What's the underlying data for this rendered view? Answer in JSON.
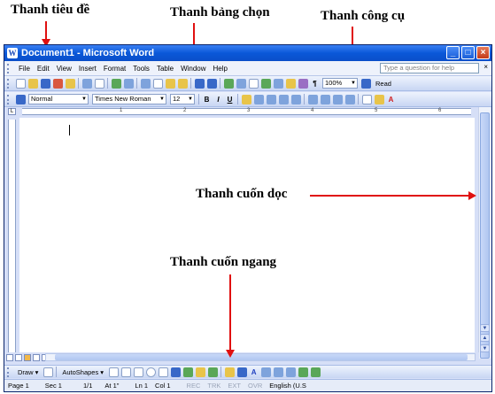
{
  "annotations": {
    "title_bar": "Thanh tiêu đề",
    "menu_bar": "Thanh bảng chọn",
    "toolbar": "Thanh công cụ",
    "vertical_scroll": "Thanh cuốn dọc",
    "horizontal_scroll": "Thanh cuốn ngang",
    "arrow_color": "#e01010"
  },
  "window": {
    "title": "Document1 - Microsoft Word",
    "app_icon": "W",
    "title_color": "#0a58d8",
    "buttons": {
      "minimize": "_",
      "maximize": "□",
      "close": "×"
    }
  },
  "menu": {
    "items": [
      "File",
      "Edit",
      "View",
      "Insert",
      "Format",
      "Tools",
      "Table",
      "Window",
      "Help"
    ],
    "help_placeholder": "Type a question for help",
    "close_doc": "×"
  },
  "standard_toolbar": {
    "zoom": "100%",
    "pilcrow": "¶",
    "read_label": "Read",
    "icons": [
      "new-icon",
      "open-icon",
      "save-icon",
      "permission-icon",
      "email-icon",
      "print-icon",
      "print-preview-icon",
      "spelling-icon",
      "research-icon",
      "cut-icon",
      "copy-icon",
      "paste-icon",
      "format-painter-icon",
      "undo-icon",
      "redo-icon",
      "hyperlink-icon",
      "tables-borders-icon",
      "insert-table-icon",
      "insert-excel-icon",
      "columns-icon",
      "drawing-icon",
      "document-map-icon",
      "show-hide-icon"
    ]
  },
  "formatting_toolbar": {
    "style": "Normal",
    "font": "Times New Roman",
    "size": "12",
    "bold": "B",
    "italic": "I",
    "underline": "U"
  },
  "ruler": {
    "corner": "L",
    "numbers": [
      "1",
      "2",
      "3",
      "4",
      "5",
      "6"
    ]
  },
  "scroll": {
    "up": "▲",
    "down": "▼"
  },
  "drawing_toolbar": {
    "draw_label": "Draw ▾",
    "autoshapes_label": "AutoShapes ▾",
    "text_a": "A"
  },
  "status_bar": {
    "page": "Page 1",
    "sec": "Sec 1",
    "pages": "1/1",
    "at": "At 1\"",
    "ln": "Ln 1",
    "col": "Col 1",
    "rec": "REC",
    "trk": "TRK",
    "ext": "EXT",
    "ovr": "OVR",
    "language": "English (U.S"
  }
}
